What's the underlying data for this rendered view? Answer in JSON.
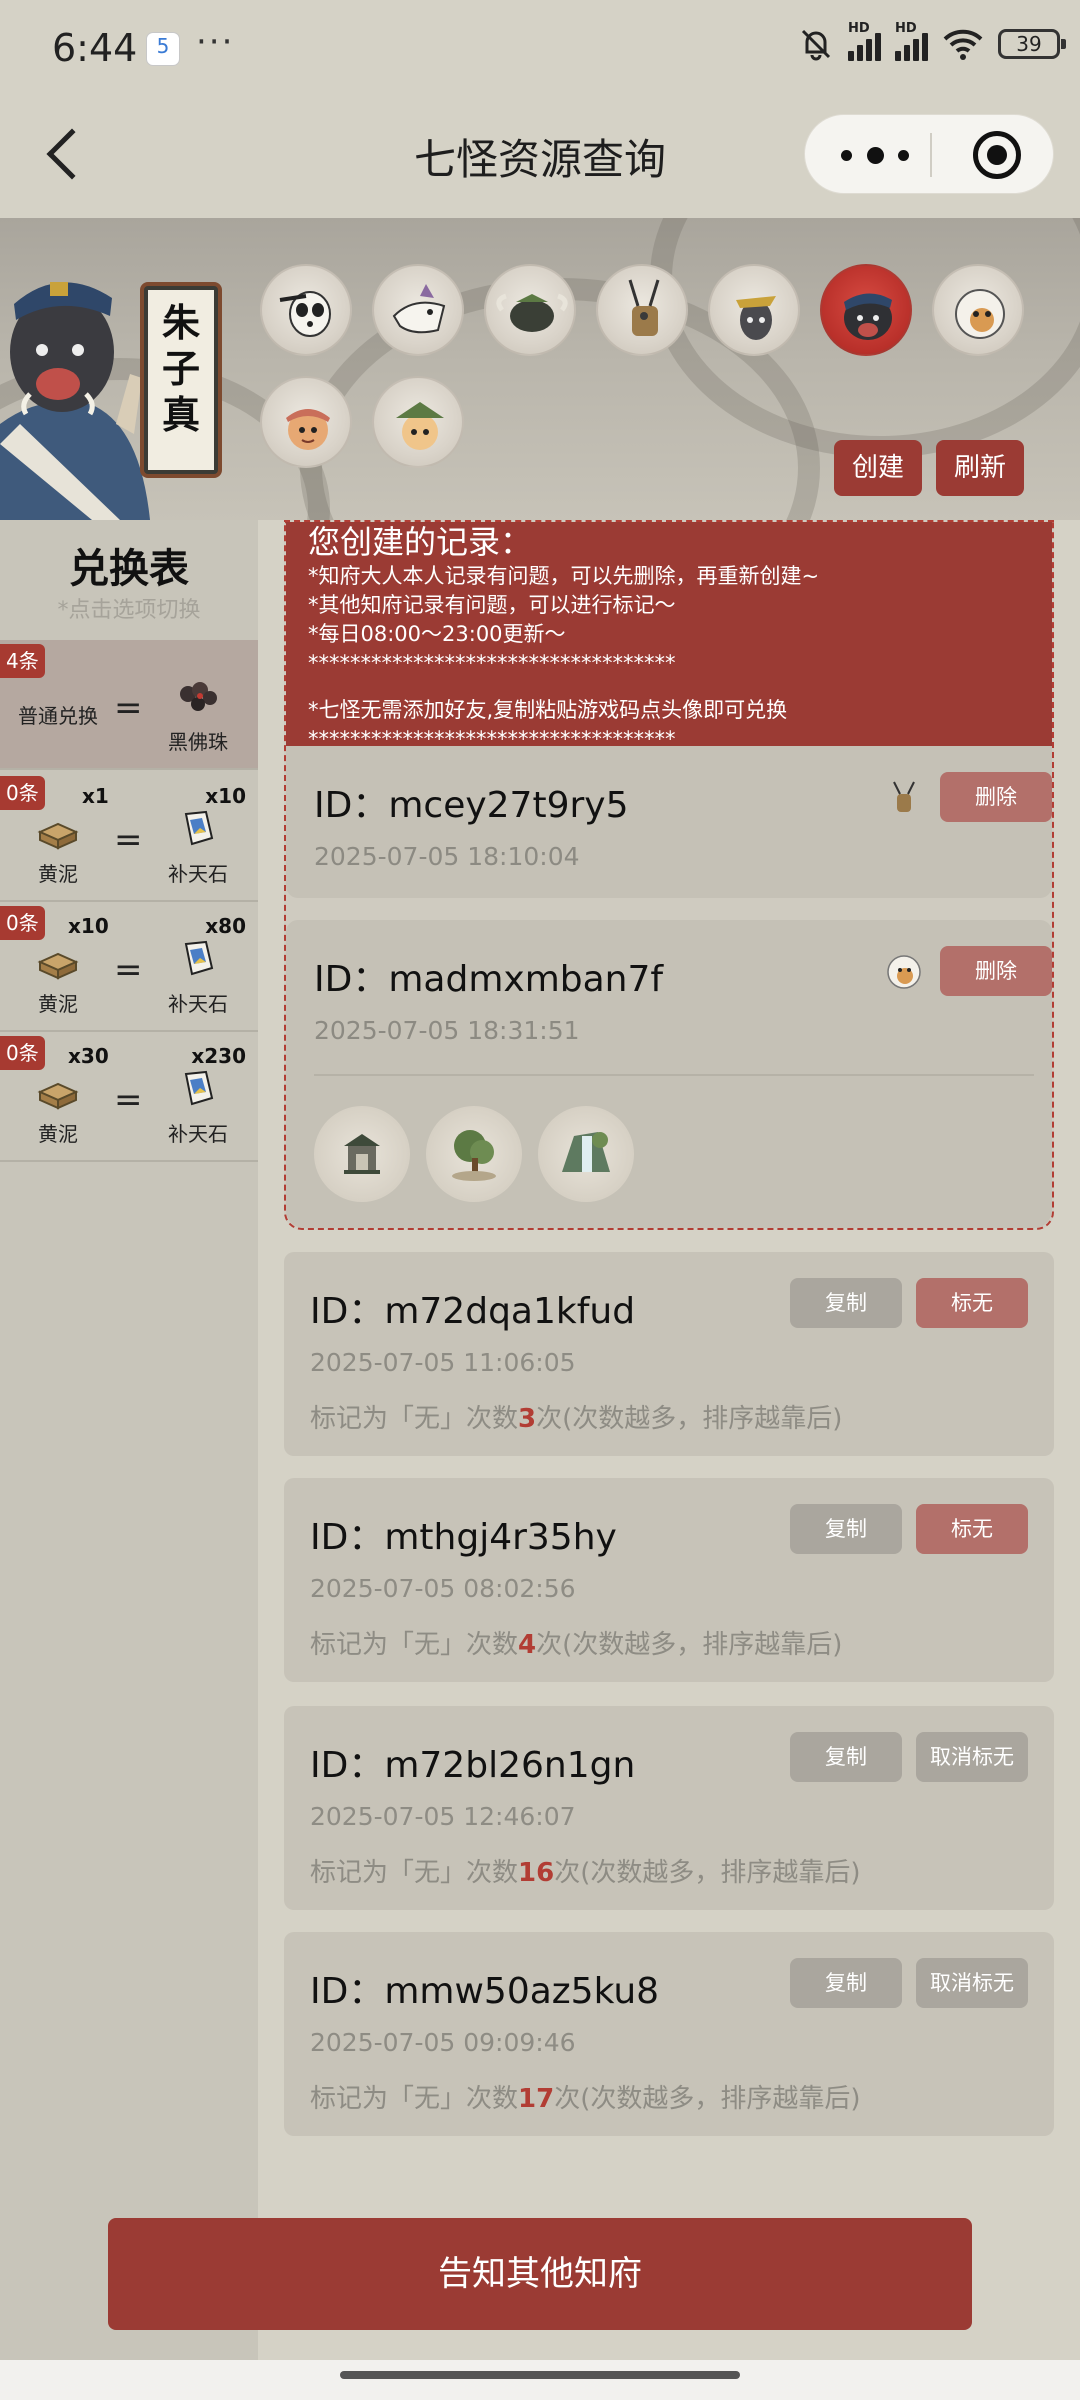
{
  "status_bar": {
    "time": "6:44",
    "app_badge": "5",
    "more": "···",
    "network_1": "HD",
    "network_2": "HD",
    "battery": "39"
  },
  "title_bar": {
    "title": "七怪资源查询"
  },
  "banner": {
    "hero_name": "朱子真",
    "create_label": "创建",
    "refresh_label": "刷新",
    "colors": {
      "accent": "#9b3b34",
      "selected_ring": "#b9302a"
    }
  },
  "sidebar": {
    "title": "兑换表",
    "hint": "*点击选项切换",
    "rows": [
      {
        "count": "4条",
        "left_qty": "",
        "right_qty": "",
        "left_item": "普通兑换",
        "right_item": "黑佛珠"
      },
      {
        "count": "0条",
        "left_qty": "x1",
        "right_qty": "x10",
        "left_item": "黄泥",
        "right_item": "补天石"
      },
      {
        "count": "0条",
        "left_qty": "x10",
        "right_qty": "x80",
        "left_item": "黄泥",
        "right_item": "补天石"
      },
      {
        "count": "0条",
        "left_qty": "x30",
        "right_qty": "x230",
        "left_item": "黄泥",
        "right_item": "补天石"
      }
    ]
  },
  "notice": {
    "title": "您创建的记录：",
    "lines": [
      "*知府大人本人记录有问题，可以先删除，再重新创建~",
      "*其他知府记录有问题，可以进行标记～",
      "*每日08:00～23:00更新～",
      "***********************************",
      "*七怪无需添加好友,复制粘贴游戏码点头像即可兑换",
      "***********************************"
    ]
  },
  "own_records": [
    {
      "id": "ID：mcey27t9ry5",
      "time": "2025-07-05 18:10:04",
      "delete_label": "删除"
    },
    {
      "id": "ID：madmxmban7f",
      "time": "2025-07-05 18:31:51",
      "delete_label": "删除"
    }
  ],
  "other_records": [
    {
      "id": "ID：m72dqa1kfud",
      "time": "2025-07-05 11:06:05",
      "copy_label": "复制",
      "mark_label": "标无",
      "note_prefix": "标记为「无」次数",
      "note_count": "3",
      "note_suffix": "次(次数越多，排序越靠后)"
    },
    {
      "id": "ID：mthgj4r35hy",
      "time": "2025-07-05 08:02:56",
      "copy_label": "复制",
      "mark_label": "标无",
      "note_prefix": "标记为「无」次数",
      "note_count": "4",
      "note_suffix": "次(次数越多，排序越靠后)"
    },
    {
      "id": "ID：m72bl26n1gn",
      "time": "2025-07-05 12:46:07",
      "copy_label": "复制",
      "mark_label": "取消标无",
      "note_prefix": "标记为「无」次数",
      "note_count": "16",
      "note_suffix": "次(次数越多，排序越靠后)"
    },
    {
      "id": "ID：mmw50az5ku8",
      "time": "2025-07-05 09:09:46",
      "copy_label": "复制",
      "mark_label": "取消标无",
      "note_prefix": "标记为「无」次数",
      "note_count": "17",
      "note_suffix": "次(次数越多，排序越靠后)"
    }
  ],
  "footer": {
    "notify_label": "告知其他知府"
  }
}
